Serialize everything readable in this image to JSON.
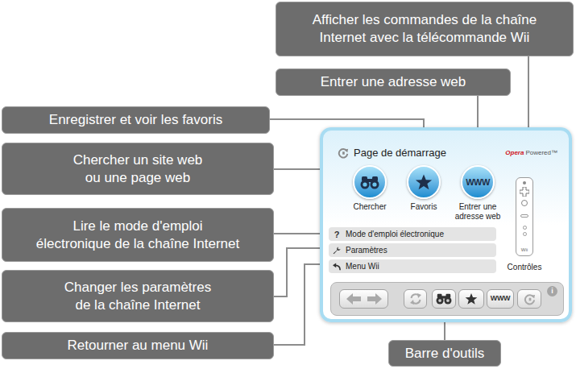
{
  "callouts": [
    {
      "lines": [
        "Afficher les commandes de la chaîne",
        "Internet avec la télécommande Wii"
      ]
    },
    {
      "lines": [
        "Entrer une adresse web"
      ]
    },
    {
      "lines": [
        "Enregistrer et voir les favoris"
      ]
    },
    {
      "lines": [
        "Chercher un site web",
        "ou une page web"
      ]
    },
    {
      "lines": [
        "Lire le mode d'emploi",
        "électronique de la chaîne Internet"
      ]
    },
    {
      "lines": [
        "Changer les paramètres",
        "de la chaîne Internet"
      ]
    },
    {
      "lines": [
        "Retourner au menu Wii"
      ]
    },
    {
      "lines": [
        "Barre d'outils"
      ]
    }
  ],
  "screen": {
    "title": "Page de démarrage",
    "brand": {
      "name": "Opera",
      "suffix": "Powered™"
    },
    "buttons": [
      {
        "kind": "binoculars",
        "label_lines": [
          "Chercher"
        ]
      },
      {
        "kind": "star",
        "label_lines": [
          "Favoris"
        ]
      },
      {
        "kind": "www",
        "text": "WWW",
        "label_lines": [
          "Entrer une",
          "adresse web"
        ]
      }
    ],
    "menu": [
      {
        "kind": "help",
        "icon": "?",
        "label": "Mode d'emploi électronique"
      },
      {
        "kind": "settings",
        "label": "Paramètres"
      },
      {
        "kind": "back",
        "label": "Menu Wii"
      }
    ],
    "controls": {
      "label": "Contrôles",
      "remote_text": "Wii"
    },
    "toolbar": [
      {
        "kind": "history",
        "disabled": true
      },
      {
        "kind": "refresh",
        "disabled": true
      },
      {
        "kind": "search",
        "disabled": false
      },
      {
        "kind": "favorites",
        "disabled": false
      },
      {
        "kind": "address",
        "text": "WWW",
        "disabled": false
      },
      {
        "kind": "home",
        "disabled": true
      }
    ],
    "info": "i"
  }
}
